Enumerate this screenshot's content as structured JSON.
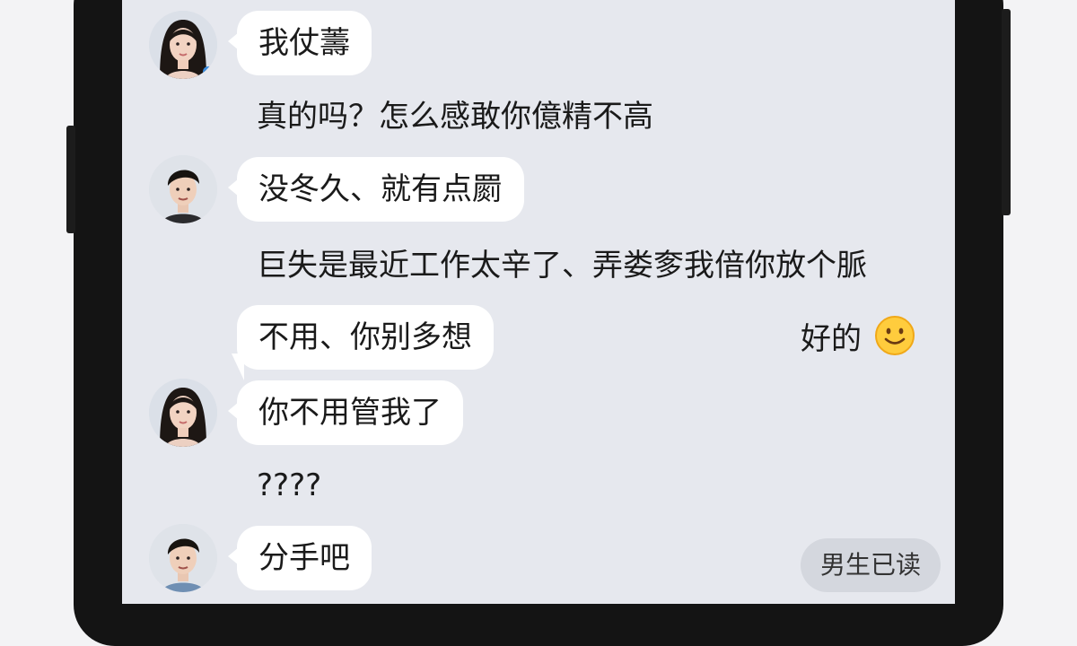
{
  "messages": [
    {
      "text": "我仗薵"
    },
    {
      "text": "真的吗？怎么感敢你億精不高"
    },
    {
      "text": "没冬久、就有点罽"
    },
    {
      "text": "巨失是最近工作太辛了、弄娄奓我偣你放个脈"
    },
    {
      "text": "不用、你别多想"
    },
    {
      "text": "你不用管我了"
    },
    {
      "text": "????"
    },
    {
      "text": "分手吧"
    }
  ],
  "reply": {
    "text": "好的",
    "emoji": "slightly-smiling-face-icon"
  },
  "status": {
    "read_label": "男生已读"
  },
  "colors": {
    "screen_bg": "#e6e8ee",
    "bubble_bg": "#ffffff",
    "pill_bg": "#d4d7de",
    "frame": "#141414"
  }
}
